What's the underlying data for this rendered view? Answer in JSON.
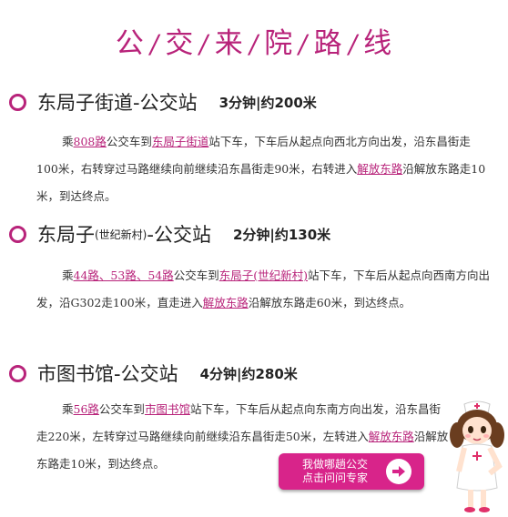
{
  "title_chars": [
    "公",
    "交",
    "来",
    "院",
    "路",
    "线"
  ],
  "sections": [
    {
      "name": "东局子街道",
      "subname": "",
      "suffix": "-公交站",
      "distance": "3分钟|约200米",
      "parts": [
        {
          "t": "乘"
        },
        {
          "t": "808路",
          "link": true
        },
        {
          "t": "公交车到"
        },
        {
          "t": "东局子街道",
          "link": true
        },
        {
          "t": "站下车，下车后从起点向西北方向出发，沿东昌街走100米，右转穿过马路继续向前继续沿东昌街走90米，右转进入"
        },
        {
          "t": "解放东路",
          "link": true
        },
        {
          "t": "沿解放东路走10米，到达终点。"
        }
      ]
    },
    {
      "name": "东局子",
      "subname": "(世纪新村)",
      "suffix": "-公交站",
      "distance": "2分钟|约130米",
      "parts": [
        {
          "t": "乘"
        },
        {
          "t": "44路、53路、54路",
          "link": true
        },
        {
          "t": "公交车到"
        },
        {
          "t": "东局子(世纪新村)",
          "link": true
        },
        {
          "t": "站下车，下车后从起点向西南方向出发，沿G302走100米，直走进入"
        },
        {
          "t": "解放东路",
          "link": true
        },
        {
          "t": "沿解放东路走60米，到达终点。"
        }
      ]
    },
    {
      "name": "市图书馆",
      "subname": "",
      "suffix": "-公交站",
      "distance": "4分钟|约280米",
      "parts": [
        {
          "t": "乘"
        },
        {
          "t": "56路",
          "link": true
        },
        {
          "t": "公交车到"
        },
        {
          "t": "市图书馆",
          "link": true
        },
        {
          "t": "站下车，下车后从起点向东南方向出发，沿东昌街走220米，左转穿过马路继续向前继续沿东昌街走50米，左转进入"
        },
        {
          "t": "解放东路",
          "link": true
        },
        {
          "t": "沿解放东路走10米，到达终点。"
        }
      ]
    }
  ],
  "consult_button": {
    "line1": "我做哪趟公交",
    "line2": "点击问问专家"
  },
  "colors": {
    "accent": "#b8237a",
    "button": "#d8248a"
  },
  "icons": {
    "section_marker": "ring-icon",
    "button_arrow": "arrow-right-icon",
    "mascot": "nurse-icon"
  }
}
